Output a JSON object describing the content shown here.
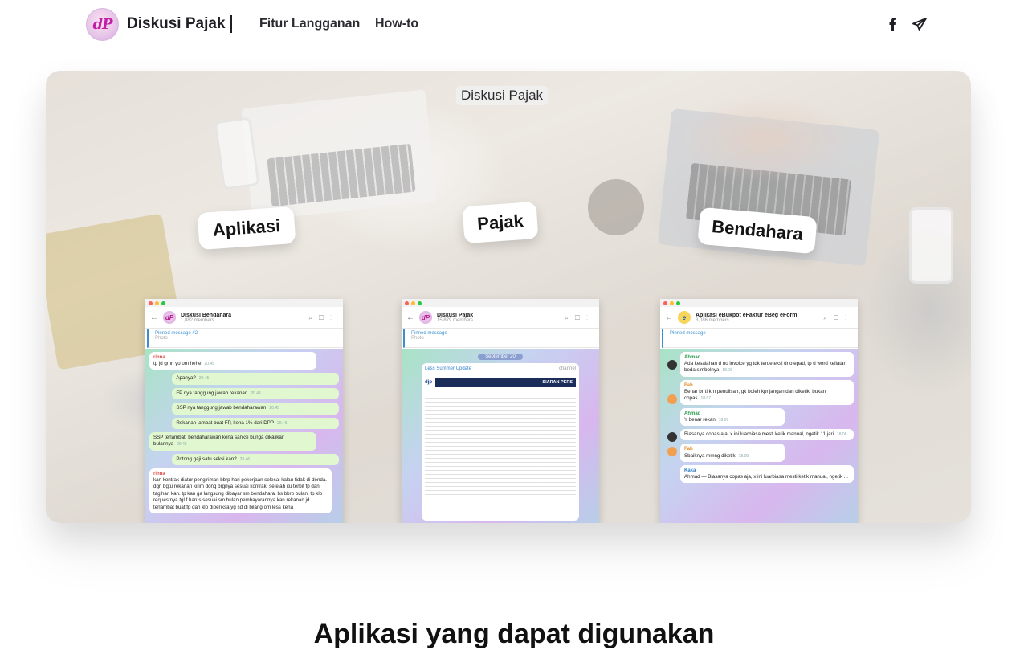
{
  "nav": {
    "brand": "Diskusi Pajak",
    "logo_mark": "dP",
    "links": [
      "Fitur Langganan",
      "How-to"
    ],
    "social": [
      "facebook-icon",
      "telegram-icon"
    ]
  },
  "hero": {
    "title": "Diskusi Pajak",
    "pills": [
      "Aplikasi",
      "Pajak",
      "Bendahara"
    ],
    "screens": [
      {
        "name": "Diskusi Bendahara",
        "members": "1,882 members",
        "pin_title": "Pinned message #2",
        "pin_sub": "Photo",
        "messages": [
          {
            "side": "in",
            "who": "rinna",
            "text": "tp jd gmn yo om hehe",
            "time": "20.45"
          },
          {
            "side": "out",
            "text": "Apanya?",
            "time": "20.45"
          },
          {
            "side": "out",
            "text": "FP nya tanggung jawab rekanan",
            "time": "20.45"
          },
          {
            "side": "out",
            "text": "SSP nya tanggung jawab bendaharawan",
            "time": "20.45"
          },
          {
            "side": "out",
            "text": "Rekanan lambat buat FP, kena 1% dari DPP",
            "time": "20.46"
          },
          {
            "side": "out",
            "text": "SSP terlambat, bendaharawan kena sanksi bunga dikalikan bulannya",
            "time": "20.46"
          },
          {
            "side": "out",
            "text": "Potong gaji satu seksi kan?",
            "time": "20.46"
          },
          {
            "side": "in",
            "who": "rinna",
            "text": "kan kontrak diatur pengiriman bbrp hari pekerjaan selesai kalau tidak di denda. dgn bgtu rekanan kirim dong brgnya sesuai kontrak. setelah itu terbit fp dan tagihan kan. tp kan ga langsung dibayar sm bendahara. bs bbrp bulan. tp klo requestnya tgl f harus sesuai sm bulan pembayarannya kan rekanan jd terlambat buat fp dan klo diperiksa yg sd di bilang om less kena"
          }
        ]
      },
      {
        "name": "Diskusi Pajak",
        "members": "15,879 members",
        "pin_title": "Pinned message",
        "pin_sub": "Photo",
        "date": "September 20",
        "post_title": "Less Summer Update",
        "post_tag": "channel",
        "doc_logo": "djp",
        "doc_title": "SIARAN PERS"
      },
      {
        "name": "Aplikasi eBukpot eFaktur eBeg eForm",
        "members": "3,086 members",
        "pin_title": "Pinned message",
        "messages": [
          {
            "who": "Ahmad",
            "color": "green",
            "text": "Ada kesalahan d no invoice yg tdk terdeteksi dnotepad, tp d word keliatan beda simbolnya",
            "time": "18.06"
          },
          {
            "who": "Fah",
            "color": "orange",
            "text": "Benar brrti krn penulisan, gk boleh kpnjangan dan diketik, bukan copas",
            "time": "18.07"
          },
          {
            "who": "Ahmad",
            "color": "green",
            "text": "Y benar rekan",
            "time": "18.07"
          },
          {
            "who": "",
            "color": "green",
            "text": "Biasanya copas aja, x ini luarbiasa mesti ketik manual, ngetik 11 jari",
            "time": "18.08"
          },
          {
            "who": "Fah",
            "color": "orange",
            "text": "Sbaiknya mmng diketik",
            "time": "18.09"
          },
          {
            "who": "Kaka",
            "color": "blue",
            "text": "Ahmad — Biasanya copas aja, x ini luarbiasa mesti ketik manual, ngetik ..."
          }
        ]
      }
    ]
  },
  "section": {
    "title": "Aplikasi yang dapat digunakan"
  }
}
